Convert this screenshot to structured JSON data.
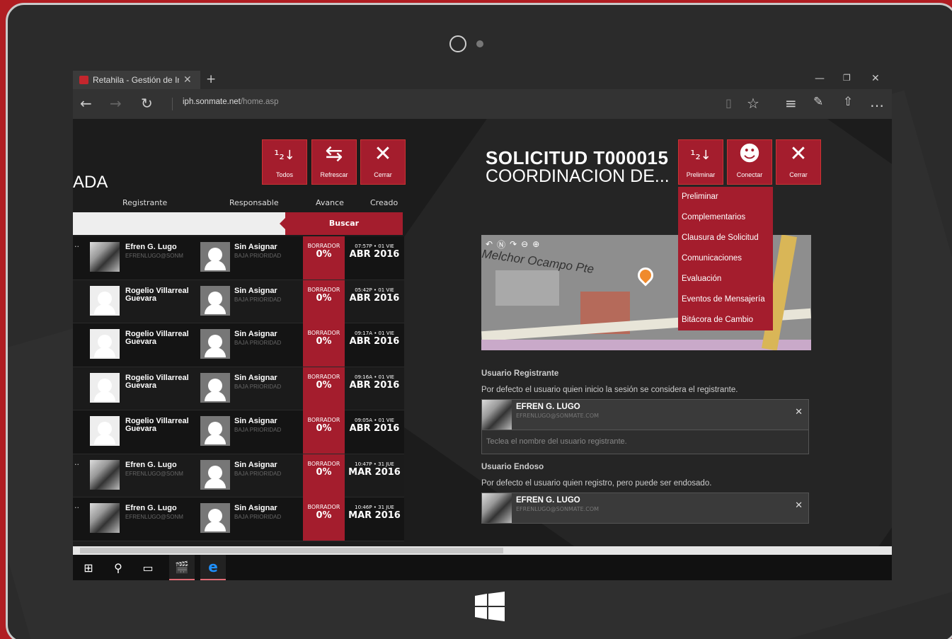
{
  "browser": {
    "tab_title": "Retahila - Gestión de In",
    "url_domain": "iph.sonmate.net",
    "url_path": "/home.asp"
  },
  "left": {
    "header": "ADA",
    "buttons": [
      {
        "label": "Todos",
        "icon": "sort-icon"
      },
      {
        "label": "Refrescar",
        "icon": "refresh-icon"
      },
      {
        "label": "Cerrar",
        "icon": "close-icon"
      }
    ],
    "columns": [
      "Registrante",
      "Responsable",
      "Avance",
      "Creado"
    ],
    "search_label": "Buscar",
    "rows": [
      {
        "reg": "Efren G. Lugo",
        "reg_email": "EFRENLUGO@SONM",
        "resp": "Sin Asignar",
        "prio": "BAJA PRIORIDAD",
        "status": "BORRADOR",
        "pct": "0%",
        "time": "07:57P • 01 VIE",
        "date": "ABR 2016"
      },
      {
        "reg": "Rogelio Villarreal Guevara",
        "reg_email": "",
        "resp": "Sin Asignar",
        "prio": "BAJA PRIORIDAD",
        "status": "BORRADOR",
        "pct": "0%",
        "time": "05:42P • 01 VIE",
        "date": "ABR 2016"
      },
      {
        "reg": "Rogelio Villarreal Guevara",
        "reg_email": "",
        "resp": "Sin Asignar",
        "prio": "BAJA PRIORIDAD",
        "status": "BORRADOR",
        "pct": "0%",
        "time": "09:17A • 01 VIE",
        "date": "ABR 2016"
      },
      {
        "reg": "Rogelio Villarreal Guevara",
        "reg_email": "",
        "resp": "Sin Asignar",
        "prio": "BAJA PRIORIDAD",
        "status": "BORRADOR",
        "pct": "0%",
        "time": "09:16A • 01 VIE",
        "date": "ABR 2016"
      },
      {
        "reg": "Rogelio Villarreal Guevara",
        "reg_email": "",
        "resp": "Sin Asignar",
        "prio": "BAJA PRIORIDAD",
        "status": "BORRADOR",
        "pct": "0%",
        "time": "09:05A • 01 VIE",
        "date": "ABR 2016"
      },
      {
        "reg": "Efren G. Lugo",
        "reg_email": "EFRENLUGO@SONM",
        "resp": "Sin Asignar",
        "prio": "BAJA PRIORIDAD",
        "status": "BORRADOR",
        "pct": "0%",
        "time": "10:47P • 31 JUE",
        "date": "MAR 2016"
      },
      {
        "reg": "Efren G. Lugo",
        "reg_email": "EFRENLUGO@SONM",
        "resp": "Sin Asignar",
        "prio": "BAJA PRIORIDAD",
        "status": "BORRADOR",
        "pct": "0%",
        "time": "10:46P • 31 JUE",
        "date": "MAR 2016"
      }
    ]
  },
  "right": {
    "title": "SOLICITUD T000015",
    "subtitle": "COORDINACION DE...",
    "buttons": [
      {
        "label": "Preliminar",
        "icon": "sort-icon"
      },
      {
        "label": "Conectar",
        "icon": "monkey-icon"
      },
      {
        "label": "Cerrar",
        "icon": "close-icon"
      }
    ],
    "menu": [
      "Preliminar",
      "Complementarios",
      "Clausura de Solicitud",
      "Comunicaciones",
      "Evaluación",
      "Eventos de Mensajería",
      "Bitácora de Cambio"
    ],
    "map_street": "Melchor Ocampo Pte",
    "registrante_label": "Usuario Registrante",
    "registrante_help": "Por defecto el usuario quien inicio la sesión se considera el registrante.",
    "registrante_name": "EFREN G. LUGO",
    "registrante_email": "EFRENLUGO@SONMATE.COM",
    "registrante_placeholder": "Teclea el nombre del usuario registrante.",
    "endoso_label": "Usuario Endoso",
    "endoso_help": "Por defecto el usuario quien registro, pero puede ser endosado.",
    "endoso_name": "EFREN G. LUGO",
    "endoso_email": "EFRENLUGO@SONMATE.COM"
  }
}
